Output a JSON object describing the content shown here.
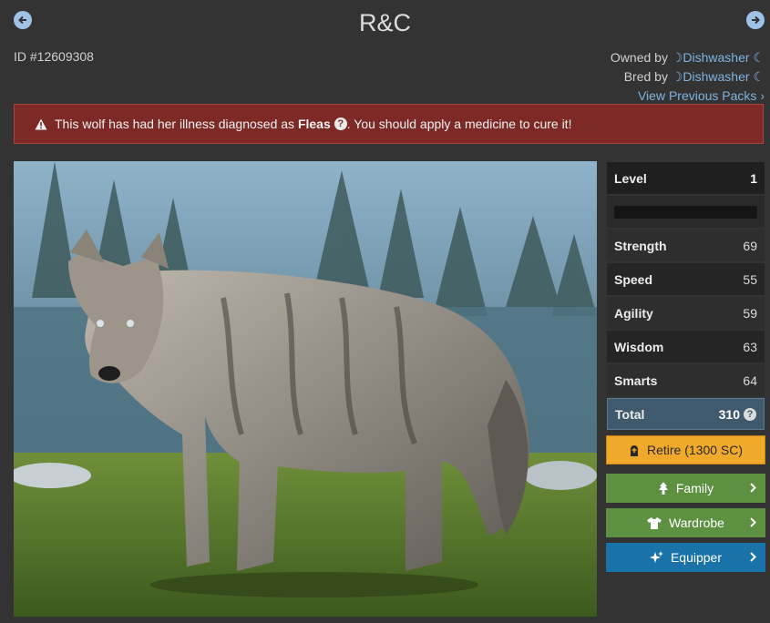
{
  "title": "R&C",
  "id_text": "ID #12609308",
  "owned_by_label": "Owned by",
  "owner_name": "Dishwasher",
  "bred_by_label": "Bred by",
  "breeder_name": "Dishwasher",
  "view_previous": "View Previous Packs",
  "alert": {
    "prefix": "This wolf has had her illness diagnosed as",
    "illness": "Fleas",
    "suffix": ". You should apply a medicine to cure it!"
  },
  "stats": {
    "level_label": "Level",
    "level_value": "1",
    "experience_fraction": 0,
    "strength_label": "Strength",
    "strength_value": "69",
    "speed_label": "Speed",
    "speed_value": "55",
    "agility_label": "Agility",
    "agility_value": "59",
    "wisdom_label": "Wisdom",
    "wisdom_value": "63",
    "smarts_label": "Smarts",
    "smarts_value": "64",
    "total_label": "Total",
    "total_value": "310"
  },
  "actions": {
    "retire": "Retire (1300 SC)",
    "family": "Family",
    "wardrobe": "Wardrobe",
    "equipper": "Equipper"
  },
  "colors": {
    "alert_bg": "#7d2a27",
    "retire": "#f0a92b",
    "family": "#5d9040",
    "equipper": "#1a73a8",
    "total_row": "#3f5a6c"
  }
}
